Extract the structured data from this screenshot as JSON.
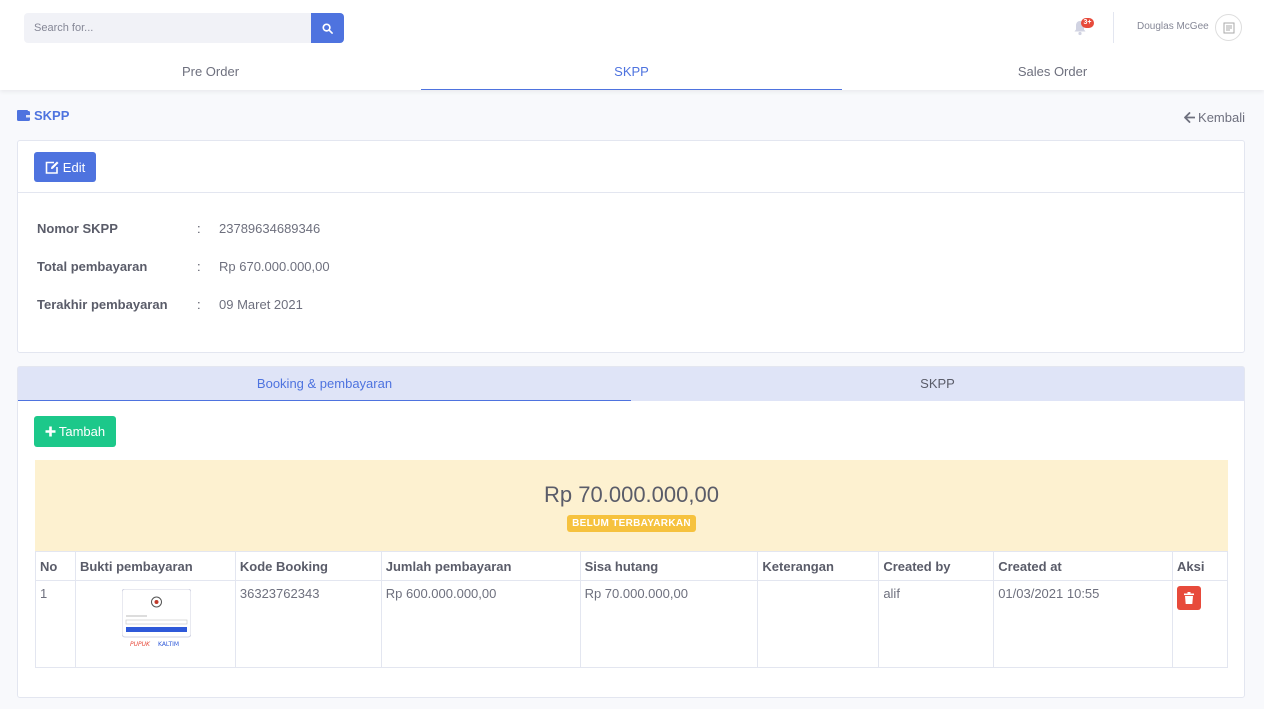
{
  "topbar": {
    "search_placeholder": "Search for...",
    "notification_count": "3+",
    "user_name": "Douglas McGee"
  },
  "nav": {
    "tabs": [
      {
        "label": "Pre Order"
      },
      {
        "label": "SKPP"
      },
      {
        "label": "Sales Order"
      }
    ],
    "active_tab": "SKPP"
  },
  "page": {
    "title": "SKPP",
    "back_label": "Kembali"
  },
  "detail": {
    "edit_label": "Edit",
    "rows": [
      {
        "label": "Nomor SKPP",
        "sep": ":",
        "value": "23789634689346"
      },
      {
        "label": "Total pembayaran",
        "sep": ":",
        "value": "Rp 670.000.000,00"
      },
      {
        "label": "Terakhir pembayaran",
        "sep": ":",
        "value": "09 Maret 2021"
      }
    ]
  },
  "sub_tabs": [
    {
      "label": "Booking & pembayaran"
    },
    {
      "label": "SKPP"
    }
  ],
  "booking": {
    "add_label": "Tambah",
    "summary_amount": "Rp 70.000.000,00",
    "summary_status": "BELUM TERBAYARKAN",
    "columns": [
      "No",
      "Bukti pembayaran",
      "Kode Booking",
      "Jumlah pembayaran",
      "Sisa hutang",
      "Keterangan",
      "Created by",
      "Created at",
      "Aksi"
    ],
    "rows": [
      {
        "no": "1",
        "kode_booking": "36323762343",
        "jumlah_pembayaran": "Rp 600.000.000,00",
        "sisa_hutang": "Rp 70.000.000,00",
        "keterangan": "",
        "created_by": "alif",
        "created_at": "01/03/2021 10:55"
      }
    ]
  },
  "colors": {
    "primary": "#4e73df",
    "success": "#1cc88a",
    "danger": "#e74a3b",
    "warning": "#f6c23e",
    "summary_bg": "#fdf1d0",
    "subtabs_bg": "#dfe4f7"
  },
  "icons": {
    "search": "search-icon",
    "bell": "bell-icon",
    "title": "wallet-icon",
    "back": "arrow-left-icon",
    "edit": "edit-icon",
    "add": "plus-icon",
    "delete": "trash-icon"
  }
}
